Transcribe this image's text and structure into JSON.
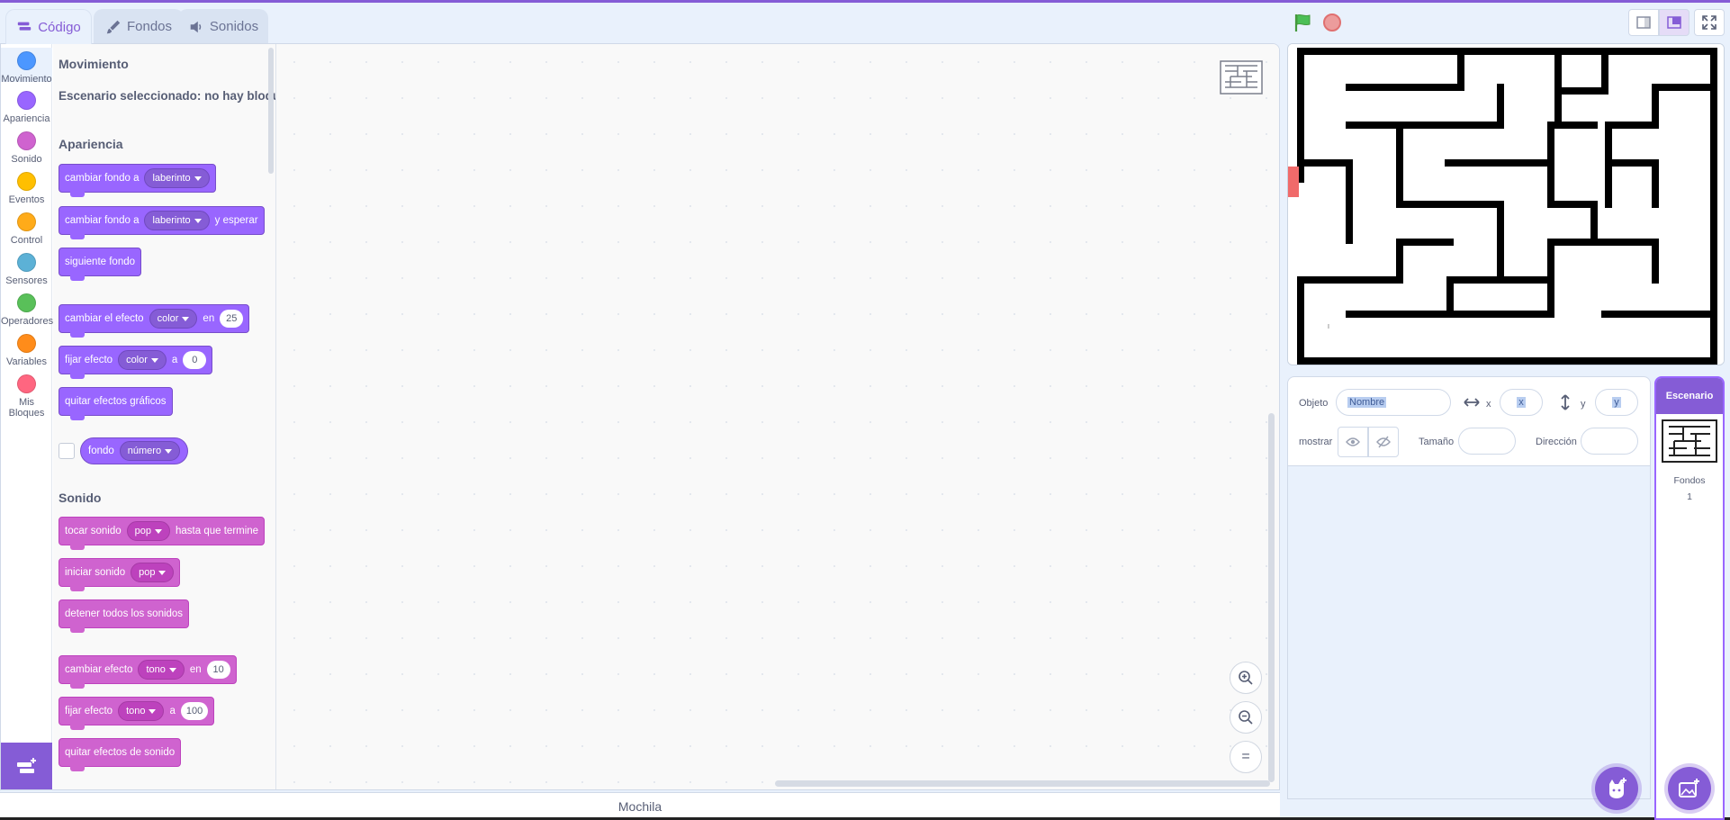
{
  "tabs": [
    {
      "label": "Código",
      "icon": "code-icon",
      "active": true
    },
    {
      "label": "Fondos",
      "icon": "brush-icon",
      "active": false
    },
    {
      "label": "Sonidos",
      "icon": "speaker-icon",
      "active": false
    }
  ],
  "categories": [
    {
      "label": "Movimiento",
      "color": "#4c97ff"
    },
    {
      "label": "Apariencia",
      "color": "#9966ff"
    },
    {
      "label": "Sonido",
      "color": "#cf63cf"
    },
    {
      "label": "Eventos",
      "color": "#ffbf00"
    },
    {
      "label": "Control",
      "color": "#ffab19"
    },
    {
      "label": "Sensores",
      "color": "#5cb1d6"
    },
    {
      "label": "Operadores",
      "color": "#59c059"
    },
    {
      "label": "Variables",
      "color": "#ff8c1a"
    },
    {
      "label": "Mis Bloques",
      "color": "#ff6680"
    }
  ],
  "flyout": {
    "motion_title": "Movimiento",
    "motion_note": "Escenario seleccionado: no hay bloques de movimiento",
    "looks_title": "Apariencia",
    "sound_title": "Sonido",
    "looks_blocks": {
      "switch_backdrop": {
        "text": "cambiar fondo a",
        "menu": "laberinto"
      },
      "switch_backdrop_wait": {
        "text": "cambiar fondo a",
        "menu": "laberinto",
        "suffix": "y esperar"
      },
      "next_backdrop": "siguiente fondo",
      "change_effect": {
        "text": "cambiar el efecto",
        "menu": "color",
        "mid": "en",
        "value": "25"
      },
      "set_effect": {
        "text": "fijar efecto",
        "menu": "color",
        "mid": "a",
        "value": "0"
      },
      "clear_effects": "quitar efectos gráficos",
      "backdrop_reporter": {
        "text": "fondo",
        "menu": "número"
      }
    },
    "sound_blocks": {
      "play_until_done": {
        "text": "tocar sonido",
        "menu": "pop",
        "suffix": "hasta que termine"
      },
      "start_sound": {
        "text": "iniciar sonido",
        "menu": "pop"
      },
      "stop_all": "detener todos los sonidos",
      "change_effect": {
        "text": "cambiar efecto",
        "menu": "tono",
        "mid": "en",
        "value": "10"
      },
      "set_effect": {
        "text": "fijar efecto",
        "menu": "tono",
        "mid": "a",
        "value": "100"
      },
      "clear_effects": "quitar efectos de sonido"
    }
  },
  "workspace": {
    "zoom_reset": "="
  },
  "backpack": {
    "label": "Mochila"
  },
  "sprite_info": {
    "sprite_label": "Objeto",
    "name_placeholder": "Nombre",
    "x_label": "x",
    "x_placeholder": "x",
    "y_label": "y",
    "y_placeholder": "y",
    "show_label": "mostrar",
    "size_label": "Tamaño",
    "direction_label": "Dirección"
  },
  "stage_pane": {
    "header": "Escenario",
    "backdrops_label": "Fondos",
    "backdrops_count": "1"
  },
  "stage": {
    "tiny_text": "I"
  },
  "colors": {
    "accent": "#855cd6",
    "looks": "#9966ff",
    "sound": "#cf63cf",
    "flag": "#4cbf56",
    "stop": "#ec9c9c",
    "sprite_marker": "#f06a6a"
  }
}
